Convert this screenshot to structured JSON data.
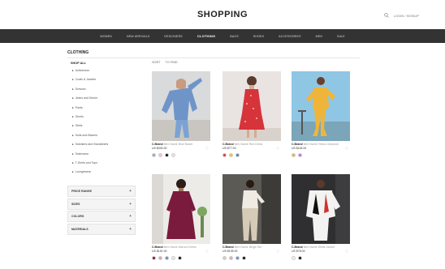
{
  "header": {
    "logo": "SHOPPING",
    "account": "LOGIN / SIGNUP"
  },
  "nav": [
    "WOMEN",
    "NEW ARRIVALS",
    "DESIGNERS",
    "CLOTHING",
    "BAGS",
    "SHOES",
    "ACCESSORIES",
    "MEN",
    "SALE"
  ],
  "nav_active_index": 3,
  "section_title": "CLOTHING",
  "sidebar": {
    "heading": "SHOP ALL",
    "items": [
      "Activewear",
      "Coats & Jackets",
      "Dresses",
      "Jeans and Denim",
      "Pants",
      "Shorts",
      "Skirts",
      "Suits and Blazers",
      "Sweaters and Sweatshirts",
      "Swimwear",
      "T-Shirts and Tops",
      "Loungewear"
    ]
  },
  "filters": [
    "PRICE RANGE",
    "SIZES",
    "COLORS",
    "MATERIALS"
  ],
  "sort": {
    "label": "SORT",
    "value": "TO FIND"
  },
  "colors": {
    "nav_bg": "#333333",
    "accent": "#222222"
  },
  "products": [
    {
      "brand": "C.Brand",
      "name": "Item Name Blue Blazer",
      "price": "US $330.00",
      "img": "img-blue",
      "swatches": [
        "#8fb0cf",
        "#f2c7c7",
        "#111111",
        "#e8e8e8"
      ]
    },
    {
      "brand": "C.Brand",
      "name": "Item Name Red Dress",
      "price": "US $77.00",
      "img": "img-red",
      "swatches": [
        "#d9363e",
        "#f1c232",
        "#5e7fa3"
      ]
    },
    {
      "brand": "C.Brand",
      "name": "Item Name Yellow Jumpsuit",
      "price": "US $118.00",
      "img": "img-yellow",
      "swatches": [
        "#f1b43c",
        "#c76fd1"
      ]
    },
    {
      "brand": "C.Brand",
      "name": "Item Name Maroon Dress",
      "price": "US $151.00",
      "img": "img-maroon",
      "swatches": [
        "#7b1b3a",
        "#e6a1b3",
        "#5f8fb0",
        "#ececec",
        "#111111"
      ]
    },
    {
      "brand": "C.Brand",
      "name": "Item Name Beige Set",
      "price": "US $105.00",
      "img": "img-beige",
      "swatches": [
        "#d8cdbd",
        "#e3a7b4",
        "#6b8ec4",
        "#111111"
      ]
    },
    {
      "brand": "C.Brand",
      "name": "Item Name White Jacket",
      "price": "US $78.00",
      "img": "img-white",
      "swatches": [
        "#f2f2f2",
        "#111111"
      ]
    }
  ]
}
